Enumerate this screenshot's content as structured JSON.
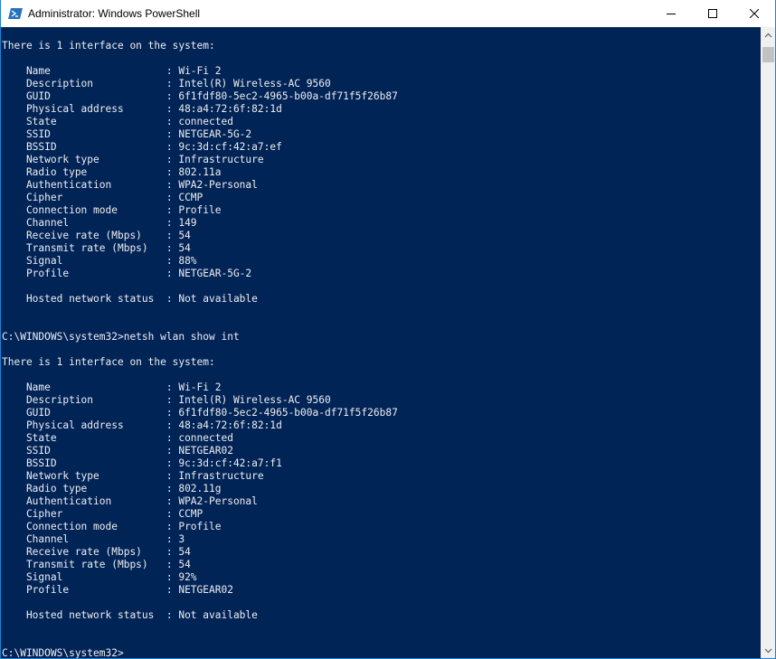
{
  "window": {
    "title": "Administrator: Windows PowerShell",
    "minimize_icon": "minimize-icon",
    "maximize_icon": "maximize-icon",
    "close_icon": "close-icon",
    "app_icon": "powershell-icon",
    "colors": {
      "console_background": "#012456",
      "console_text": "#eeedf0",
      "titlebar": "#ffffff"
    }
  },
  "console": {
    "lines": [
      "There is 1 interface on the system:",
      "",
      "    Name                   : Wi-Fi 2",
      "    Description            : Intel(R) Wireless-AC 9560",
      "    GUID                   : 6f1fdf80-5ec2-4965-b00a-df71f5f26b87",
      "    Physical address       : 48:a4:72:6f:82:1d",
      "    State                  : connected",
      "    SSID                   : NETGEAR-5G-2",
      "    BSSID                  : 9c:3d:cf:42:a7:ef",
      "    Network type           : Infrastructure",
      "    Radio type             : 802.11a",
      "    Authentication         : WPA2-Personal",
      "    Cipher                 : CCMP",
      "    Connection mode        : Profile",
      "    Channel                : 149",
      "    Receive rate (Mbps)    : 54",
      "    Transmit rate (Mbps)   : 54",
      "    Signal                 : 88%",
      "    Profile                : NETGEAR-5G-2",
      "",
      "    Hosted network status  : Not available",
      "",
      "",
      "C:\\WINDOWS\\system32>netsh wlan show int",
      "",
      "There is 1 interface on the system:",
      "",
      "    Name                   : Wi-Fi 2",
      "    Description            : Intel(R) Wireless-AC 9560",
      "    GUID                   : 6f1fdf80-5ec2-4965-b00a-df71f5f26b87",
      "    Physical address       : 48:a4:72:6f:82:1d",
      "    State                  : connected",
      "    SSID                   : NETGEAR02",
      "    BSSID                  : 9c:3d:cf:42:a7:f1",
      "    Network type           : Infrastructure",
      "    Radio type             : 802.11g",
      "    Authentication         : WPA2-Personal",
      "    Cipher                 : CCMP",
      "    Connection mode        : Profile",
      "    Channel                : 3",
      "    Receive rate (Mbps)    : 54",
      "    Transmit rate (Mbps)   : 54",
      "    Signal                 : 92%",
      "    Profile                : NETGEAR02",
      "",
      "    Hosted network status  : Not available",
      "",
      "",
      "C:\\WINDOWS\\system32>"
    ]
  },
  "scrollbar": {
    "up_icon": "scroll-up-arrow-icon",
    "down_icon": "scroll-down-arrow-icon"
  }
}
